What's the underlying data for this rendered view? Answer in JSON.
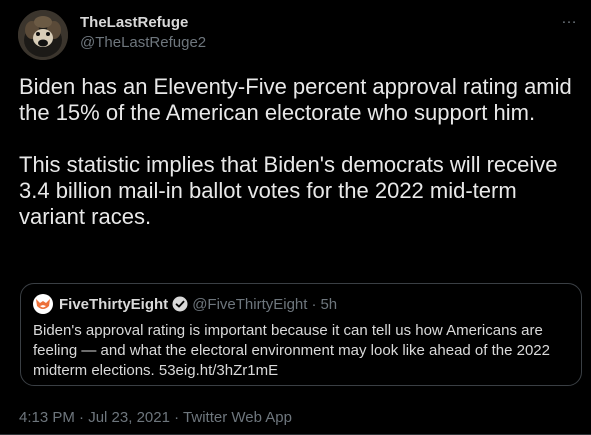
{
  "author": {
    "display_name": "TheLastRefuge",
    "handle": "@TheLastRefuge2",
    "avatar_icon": "dog-avatar-icon"
  },
  "more_icon": "…",
  "tweet": {
    "text": "Biden has an Eleventy-Five percent approval rating amid the 15% of the American electorate who support him.\n\nThis statistic implies that Biden's democrats will receive 3.4 billion mail-in ballot votes for the 2022 mid-term variant races."
  },
  "quoted_tweet": {
    "display_name": "FiveThirtyEight",
    "handle": "@FiveThirtyEight",
    "separator": "·",
    "time_ago": "5h",
    "text": "Biden's approval rating is important because it can tell us how Americans are feeling — and what the electoral environment may look like ahead of the 2022 midterm elections. 53eig.ht/3hZr1mE",
    "logo_icon": "fivethirtyeight-fox-icon",
    "verified_icon": "verified-badge-icon"
  },
  "meta": {
    "time": "4:13 PM",
    "date": "Jul 23, 2021",
    "source": "Twitter Web App",
    "separator": "·"
  },
  "colors": {
    "background": "#000000",
    "text": "#D9D9D9",
    "muted": "#6E767D",
    "border": "#3a3f44",
    "accent_orange": "#ED713A"
  }
}
